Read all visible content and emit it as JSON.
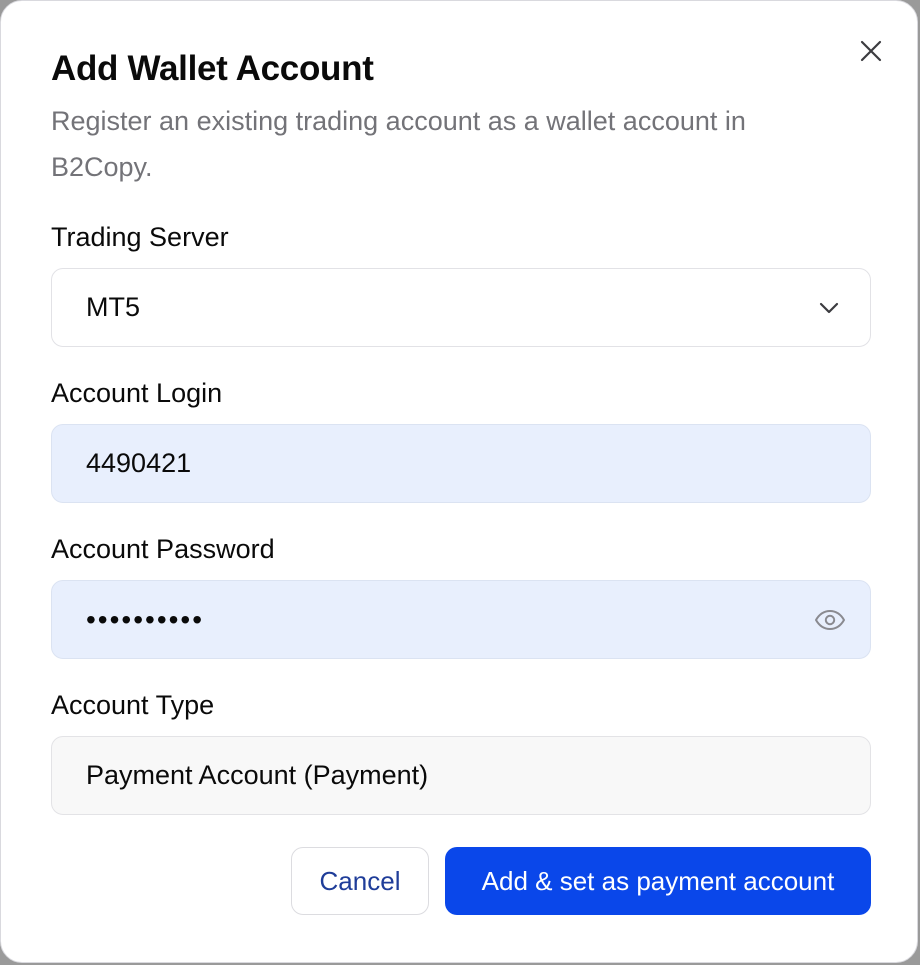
{
  "dialog": {
    "title": "Add Wallet Account",
    "description": "Register an existing trading account as a wallet account in B2Copy.",
    "close_icon": "close-icon"
  },
  "fields": {
    "trading_server": {
      "label": "Trading Server",
      "value": "MT5",
      "icon": "chevron-down-icon"
    },
    "account_login": {
      "label": "Account Login",
      "value": "4490421"
    },
    "account_password": {
      "label": "Account Password",
      "masked_value": "••••••••••",
      "icon": "eye-icon"
    },
    "account_type": {
      "label": "Account Type",
      "value": "Payment Account (Payment)"
    }
  },
  "actions": {
    "cancel_label": "Cancel",
    "submit_label": "Add & set as payment account"
  },
  "colors": {
    "primary": "#0a47ea",
    "autofill_bg": "#e8effd",
    "muted_text": "#737378",
    "cancel_text": "#1f3d99"
  }
}
